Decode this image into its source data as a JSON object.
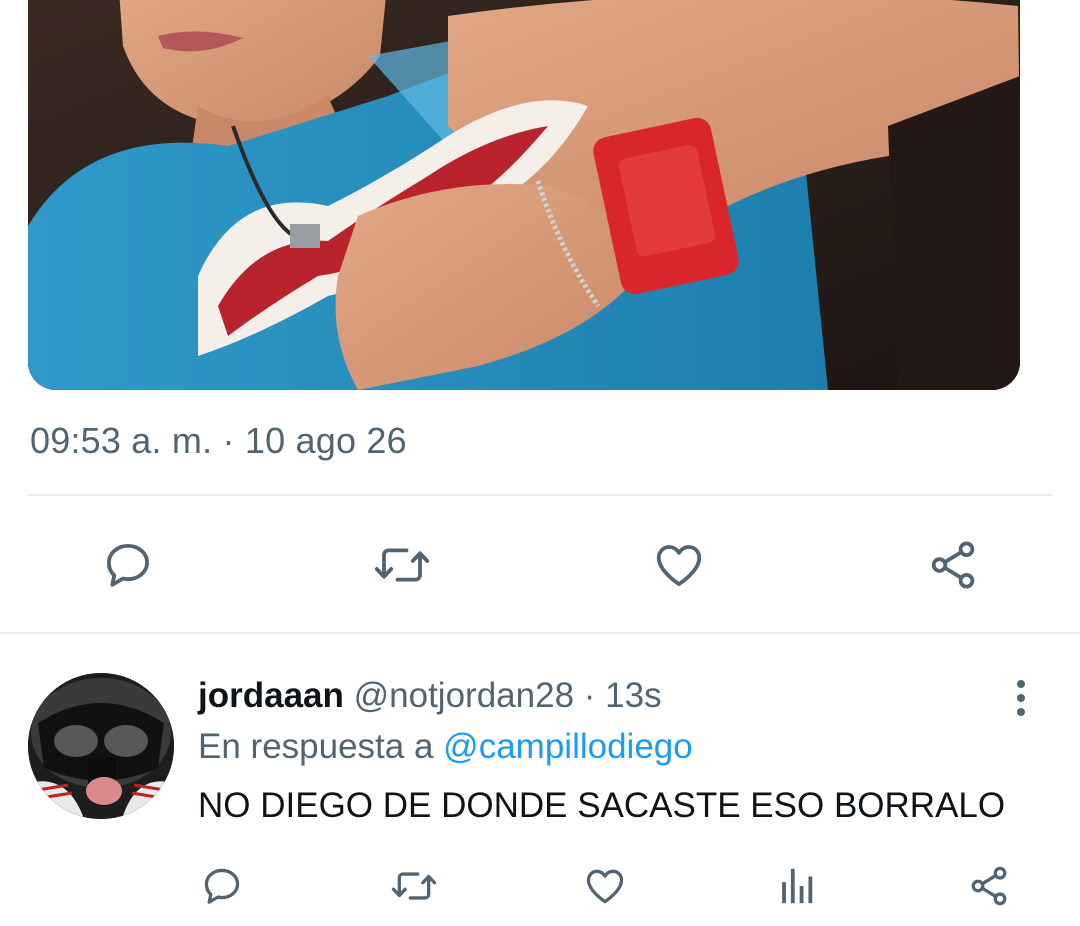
{
  "tweet": {
    "media_icon": "photo",
    "timestamp": "09:53 a. m. · 10 ago 26",
    "actions": {
      "reply_icon": "reply-icon",
      "retweet_icon": "retweet-icon",
      "like_icon": "heart-icon",
      "share_icon": "share-icon"
    }
  },
  "reply": {
    "avatar_icon": "avatar",
    "display_name": "jordaaan",
    "handle": "@notjordan28",
    "separator": "·",
    "time_ago": "13s",
    "replying_prefix": "En respuesta a",
    "replying_to": "@campillodiego",
    "text": "NO DIEGO DE DONDE SACASTE ESO BORRALO",
    "more_icon": "more-vertical-icon",
    "actions": {
      "reply_icon": "reply-icon",
      "retweet_icon": "retweet-icon",
      "like_icon": "heart-icon",
      "analytics_icon": "analytics-icon",
      "share_icon": "share-icon"
    }
  },
  "colors": {
    "icon_gray": "#536471",
    "mention_blue": "#1d9bf0",
    "divider": "#e7ebee"
  }
}
